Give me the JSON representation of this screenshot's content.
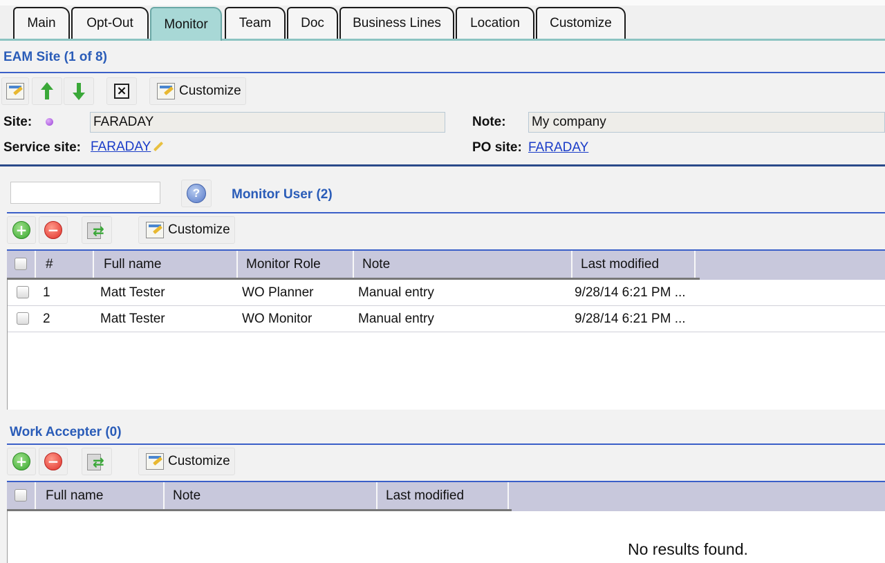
{
  "tabs": [
    {
      "label": "Main"
    },
    {
      "label": "Opt-Out"
    },
    {
      "label": "Monitor"
    },
    {
      "label": "Team"
    },
    {
      "label": "Doc"
    },
    {
      "label": "Business Lines"
    },
    {
      "label": "Location"
    },
    {
      "label": "Customize"
    }
  ],
  "active_tab": "Monitor",
  "site_section": {
    "title": "EAM Site (1 of 8)",
    "customize_label": "Customize",
    "site_label": "Site:",
    "site_value": "FARADAY",
    "service_site_label": "Service site:",
    "service_site_value": "FARADAY",
    "note_label": "Note:",
    "note_value": "My company",
    "po_site_label": "PO site:",
    "po_site_value": "FARADAY"
  },
  "monitor_user": {
    "search_value": "",
    "title": "Monitor User (2)",
    "customize_label": "Customize",
    "columns": [
      "#",
      "Full name",
      "Monitor Role",
      "Note",
      "Last modified"
    ],
    "rows": [
      {
        "num": "1",
        "full_name": "Matt Tester",
        "role": "WO Planner",
        "note": "Manual entry",
        "modified": "9/28/14 6:21 PM ..."
      },
      {
        "num": "2",
        "full_name": "Matt Tester",
        "role": "WO Monitor",
        "note": "Manual entry",
        "modified": "9/28/14 6:21 PM ..."
      }
    ]
  },
  "work_accepter": {
    "title": "Work Accepter (0)",
    "customize_label": "Customize",
    "columns": [
      "Full name",
      "Note",
      "Last modified"
    ],
    "empty_text": "No results found."
  },
  "icons": {
    "edit": "edit-doc-icon",
    "up": "arrow-up-icon",
    "down": "arrow-down-icon",
    "delete": "close-box-icon",
    "add": "add-circle-icon",
    "remove": "remove-circle-icon",
    "refresh": "refresh-icon",
    "help": "help-icon",
    "pencil": "pencil-icon",
    "status": "status-dot-icon"
  },
  "colors": {
    "accent_blue": "#2a5cb8",
    "active_tab": "#a8d8d6",
    "header_bg": "#c8c8dc",
    "link": "#1a3cc8"
  }
}
